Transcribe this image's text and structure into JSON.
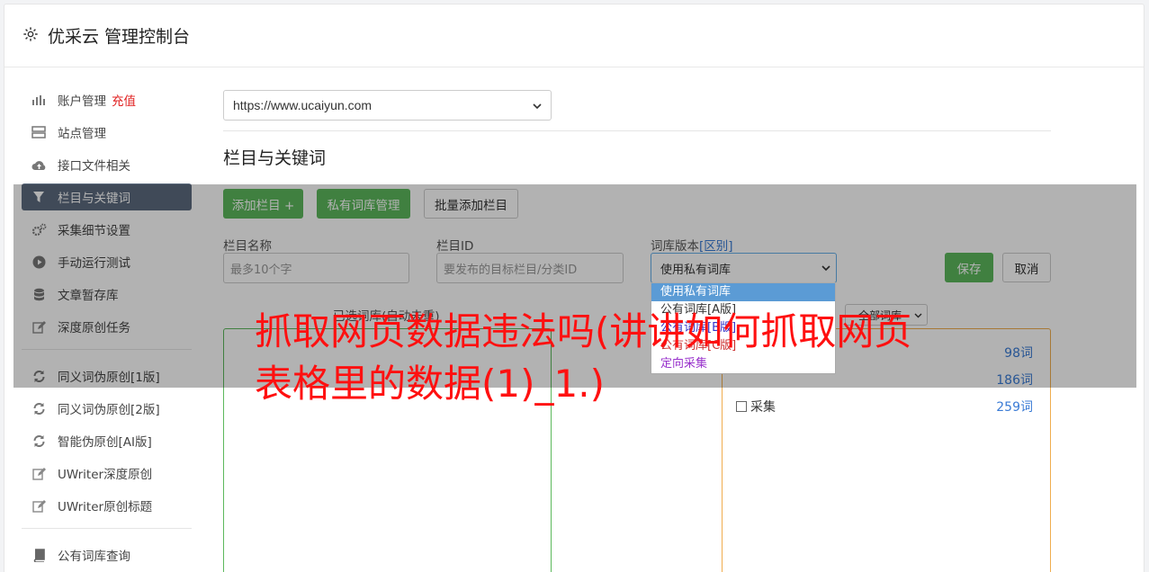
{
  "header": {
    "title": "优采云 管理控制台",
    "icon": "gear-icon"
  },
  "sidebar": {
    "items": [
      {
        "label": "账户管理",
        "icon": "bar-chart-icon",
        "badge": "充值"
      },
      {
        "label": "站点管理",
        "icon": "server-icon"
      },
      {
        "label": "接口文件相关",
        "icon": "cloud-upload-icon"
      },
      {
        "label": "栏目与关键词",
        "icon": "filter-icon",
        "active": true
      },
      {
        "label": "采集细节设置",
        "icon": "cogs-icon"
      },
      {
        "label": "手动运行测试",
        "icon": "play-icon"
      },
      {
        "label": "文章暂存库",
        "icon": "database-icon"
      },
      {
        "label": "深度原创任务",
        "icon": "edit-icon"
      }
    ],
    "items2": [
      {
        "label": "同义词伪原创[1版]",
        "icon": "refresh-icon"
      },
      {
        "label": "同义词伪原创[2版]",
        "icon": "refresh-icon"
      },
      {
        "label": "智能伪原创[AI版]",
        "icon": "refresh-icon"
      },
      {
        "label": "UWriter深度原创",
        "icon": "edit-icon"
      },
      {
        "label": "UWriter原创标题",
        "icon": "edit-icon"
      }
    ],
    "items3": [
      {
        "label": "公有词库查询",
        "icon": "book-icon"
      }
    ]
  },
  "main": {
    "site_select": "https://www.ucaiyun.com",
    "section_title": "栏目与关键词",
    "buttons": {
      "add_column": "添加栏目 +",
      "private_lib": "私有词库管理",
      "batch_add": "批量添加栏目",
      "save": "保存",
      "cancel": "取消"
    },
    "form": {
      "name_label": "栏目名称",
      "name_placeholder": "最多10个字",
      "id_label": "栏目ID",
      "id_placeholder": "要发布的目标栏目/分类ID",
      "version_label": "词库版本",
      "version_link": "[区别]",
      "version_value": "使用私有词库"
    },
    "dropdown_options": [
      {
        "label": "使用私有词库",
        "color": "#ffffff",
        "selected": true
      },
      {
        "label": "公有词库[A版]",
        "color": "#333333"
      },
      {
        "label": "公有词库[B版]",
        "color": "#3333cc"
      },
      {
        "label": "公有词库[C版]",
        "color": "#cc3333"
      },
      {
        "label": "定向采集",
        "color": "#9933cc"
      }
    ],
    "selected_lib_hint": "已选词库(自动去重)",
    "lib_filter": "全部词库",
    "lib_rows": [
      {
        "name": "",
        "count": "98词"
      },
      {
        "name": "",
        "count": "186词"
      },
      {
        "name": "采集",
        "count": "259词"
      }
    ]
  },
  "overlay_text": "抓取网页数据违法吗(讲讲如何抓取网页表格里的数据(1)_1.)",
  "colors": {
    "accent_green": "#5cb85c",
    "active_nav": "#5c6b7e",
    "headline": "#ff1010",
    "link_blue": "#3a7bd5"
  }
}
